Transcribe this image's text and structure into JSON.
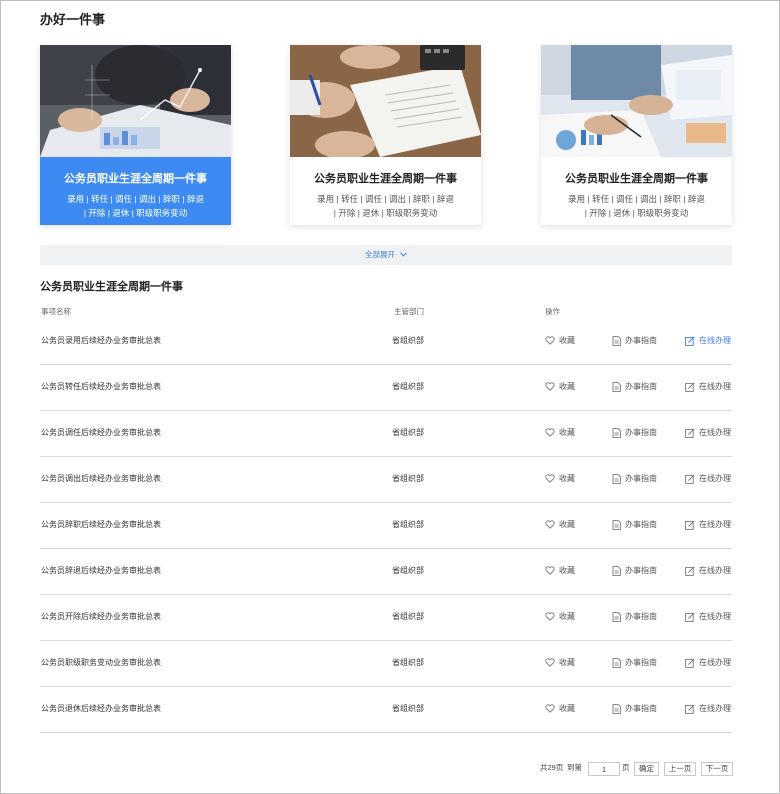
{
  "page": {
    "title": "办好一件事"
  },
  "cards": [
    {
      "title": "公务员职业生涯全周期一件事",
      "tags_line1": "录用 | 转任 | 调任 | 调出 | 辞职 | 辞退",
      "tags_line2": "| 开除 | 退休 | 职级职务变动",
      "active": true
    },
    {
      "title": "公务员职业生涯全周期一件事",
      "tags_line1": "录用 | 转任 | 调任 | 调出 | 辞职 | 辞退",
      "tags_line2": "| 开除 | 退休 | 职级职务变动",
      "active": false
    },
    {
      "title": "公务员职业生涯全周期一件事",
      "tags_line1": "录用 | 转任 | 调任 | 调出 | 辞职 | 辞退",
      "tags_line2": "| 开除 | 退休 | 职级职务变动",
      "active": false
    }
  ],
  "expand": {
    "label": "全部展开"
  },
  "section": {
    "title": "公务员职业生涯全周期一件事"
  },
  "table": {
    "headers": {
      "name": "事项名称",
      "dept": "主管部门",
      "ops": "操作"
    },
    "actions": {
      "favorite": "收藏",
      "guide": "办事指南",
      "online": "在线办理"
    },
    "rows": [
      {
        "name": "公务员录用后续经办业务审批总表",
        "dept": "省组织部"
      },
      {
        "name": "公务员转任后续经办业务审批总表",
        "dept": "省组织部"
      },
      {
        "name": "公务员调任后续经办业务审批总表",
        "dept": "省组织部"
      },
      {
        "name": "公务员调出后续经办业务审批总表",
        "dept": "省组织部"
      },
      {
        "name": "公务员辞职后续经办业务审批总表",
        "dept": "省组织部"
      },
      {
        "name": "公务员辞退后续经办业务审批总表",
        "dept": "省组织部"
      },
      {
        "name": "公务员开除后续经办业务审批总表",
        "dept": "省组织部"
      },
      {
        "name": "公务员职级职务变动业务审批总表",
        "dept": "省组织部"
      },
      {
        "name": "公务员退休后续经办业务审批总表",
        "dept": "省组织部"
      }
    ]
  },
  "pagination": {
    "total_label": "共29页",
    "goto_label": "到第",
    "page_value": "1",
    "page_unit": "页",
    "confirm": "确定",
    "prev": "上一页",
    "next": "下一页"
  },
  "colors": {
    "accent": "#3d8bf2",
    "link": "#3d7fe0",
    "expand_bg": "#f0f1f3"
  },
  "icons": {
    "favorite": "heart-icon",
    "guide": "document-icon",
    "online": "edit-icon",
    "expand": "chevron-down-icon"
  }
}
